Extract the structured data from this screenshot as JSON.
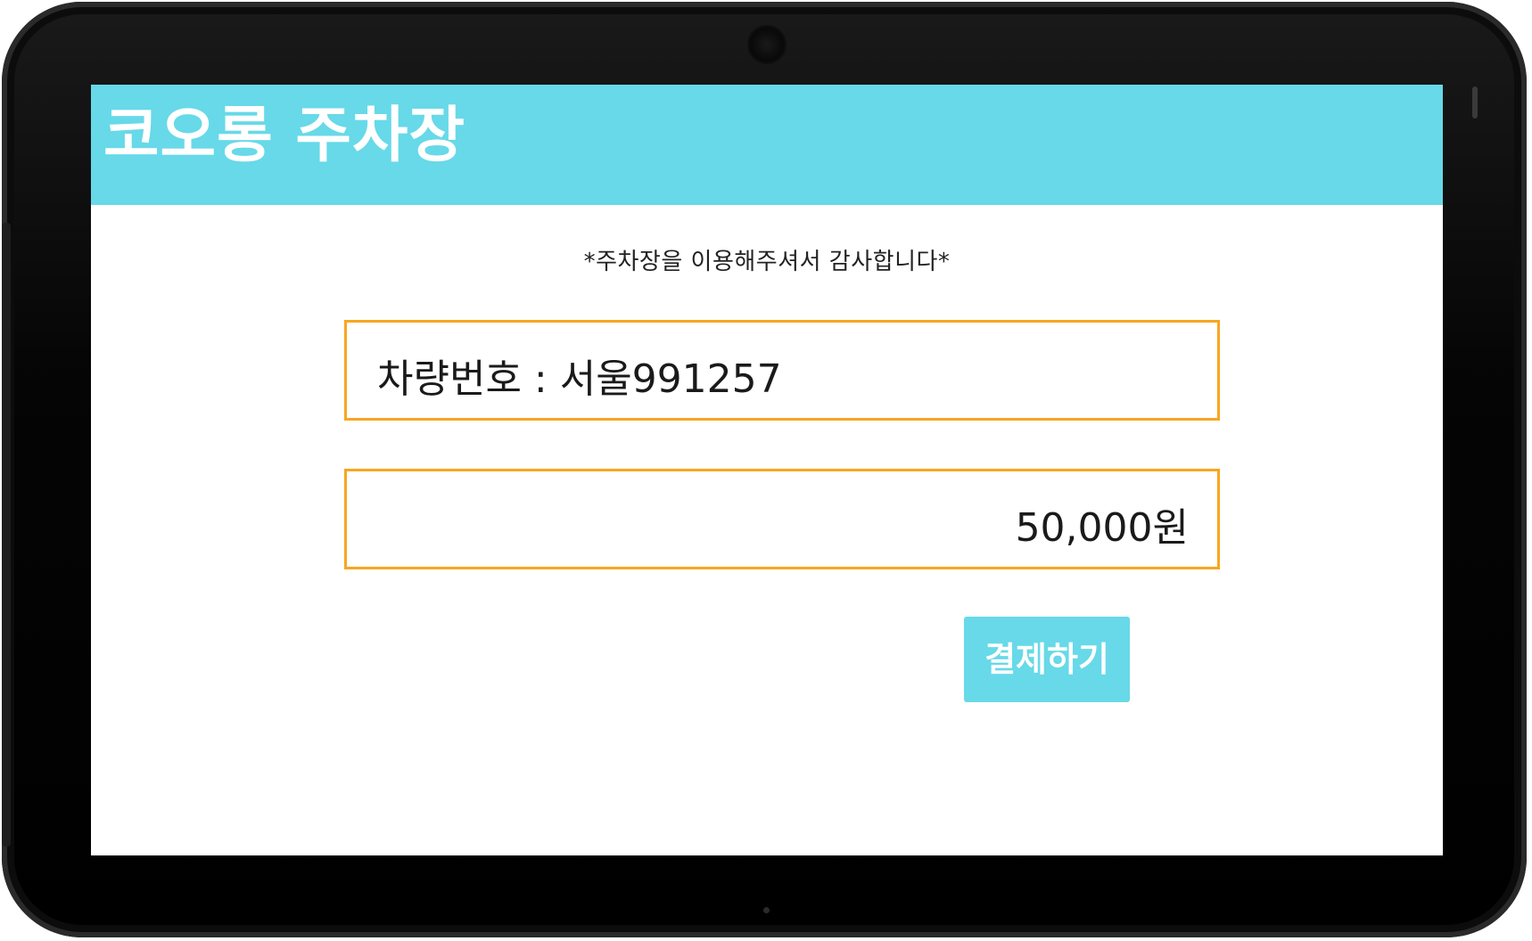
{
  "app": {
    "title": "코오롱 주차장"
  },
  "notice": {
    "thanks_message": "*주차장을 이용해주셔서 감사합니다*"
  },
  "payment": {
    "plate_label": "차량번호 : 서울991257",
    "fee_amount": "50,000원",
    "pay_button_label": "결제하기"
  },
  "colors": {
    "brand_accent": "#67d9e8",
    "field_border": "#f7a621",
    "device_bezel": "#000000",
    "text": "#1a1a1a"
  },
  "icons": {
    "camera": "front-camera-icon"
  }
}
